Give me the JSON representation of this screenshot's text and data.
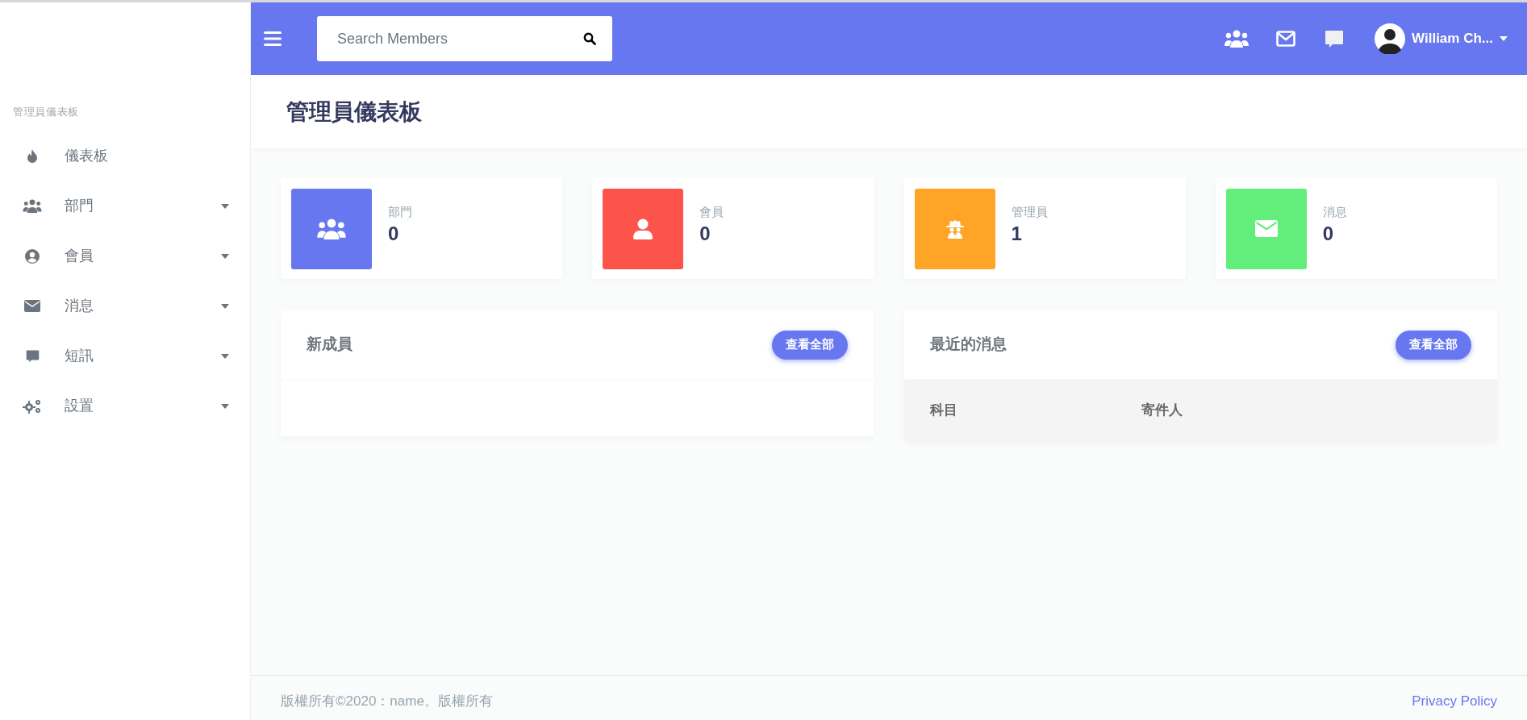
{
  "topbar": {
    "search": {
      "placeholder": "Search Members"
    },
    "user": {
      "name": "William Ch..."
    }
  },
  "sidebar": {
    "section_label": "管理員儀表板",
    "items": [
      {
        "label": "儀表板",
        "has_submenu": false
      },
      {
        "label": "部門",
        "has_submenu": true
      },
      {
        "label": "會員",
        "has_submenu": true
      },
      {
        "label": "消息",
        "has_submenu": true
      },
      {
        "label": "短訊",
        "has_submenu": true
      },
      {
        "label": "設置",
        "has_submenu": true
      }
    ]
  },
  "page_title": "管理員儀表板",
  "stats": [
    {
      "label": "部門",
      "value": "0",
      "color": "#6777ef"
    },
    {
      "label": "會員",
      "value": "0",
      "color": "#fc544b"
    },
    {
      "label": "管理員",
      "value": "1",
      "color": "#ffa426"
    },
    {
      "label": "消息",
      "value": "0",
      "color": "#63ed7a"
    }
  ],
  "panels": [
    {
      "title": "新成員",
      "button": "查看全部"
    },
    {
      "title": "最近的消息",
      "button": "查看全部",
      "table": {
        "columns": [
          "科目",
          "寄件人"
        ]
      }
    }
  ],
  "footer": {
    "copyright": "版權所有©2020：name。版權所有",
    "link": "Privacy Policy"
  }
}
